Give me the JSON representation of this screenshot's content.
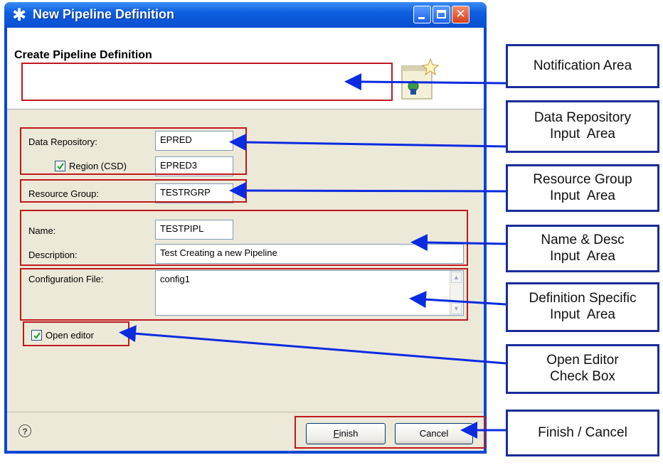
{
  "window": {
    "title": "New Pipeline Definition",
    "header_title": "Create Pipeline Definition",
    "notification_text": ""
  },
  "form": {
    "data_repository_label": "Data Repository:",
    "data_repository_value": "EPRED",
    "region_label": "Region (CSD)",
    "region_checked": true,
    "region_value": "EPRED3",
    "resource_group_label": "Resource Group:",
    "resource_group_value": "TESTRGRP",
    "name_label": "Name:",
    "name_value": "TESTPIPL",
    "description_label": "Description:",
    "description_value": "Test Creating a new Pipeline",
    "config_file_label": "Configuration File:",
    "config_file_value": "config1",
    "open_editor_label": "Open editor",
    "open_editor_checked": true
  },
  "buttons": {
    "finish": "Finish",
    "cancel": "Cancel",
    "help": "?"
  },
  "callouts": {
    "notification": "Notification Area",
    "data_repository": [
      "Data Repository",
      "Input  Area"
    ],
    "resource_group": [
      "Resource Group",
      "Input  Area"
    ],
    "name_desc": [
      "Name & Desc",
      "Input  Area"
    ],
    "definition_specific": [
      "Definition Specific",
      "Input  Area"
    ],
    "open_editor": [
      "Open Editor",
      "Check Box"
    ],
    "finish_cancel": "Finish / Cancel"
  },
  "colors": {
    "title_bar": "#0a4fcf",
    "dialog_body": "#ece9d8",
    "highlight_red": "#c0181e",
    "callout_blue": "#1a2c9a"
  },
  "icons": [
    "wizard-icon",
    "help-icon",
    "checkmark-icon"
  ]
}
